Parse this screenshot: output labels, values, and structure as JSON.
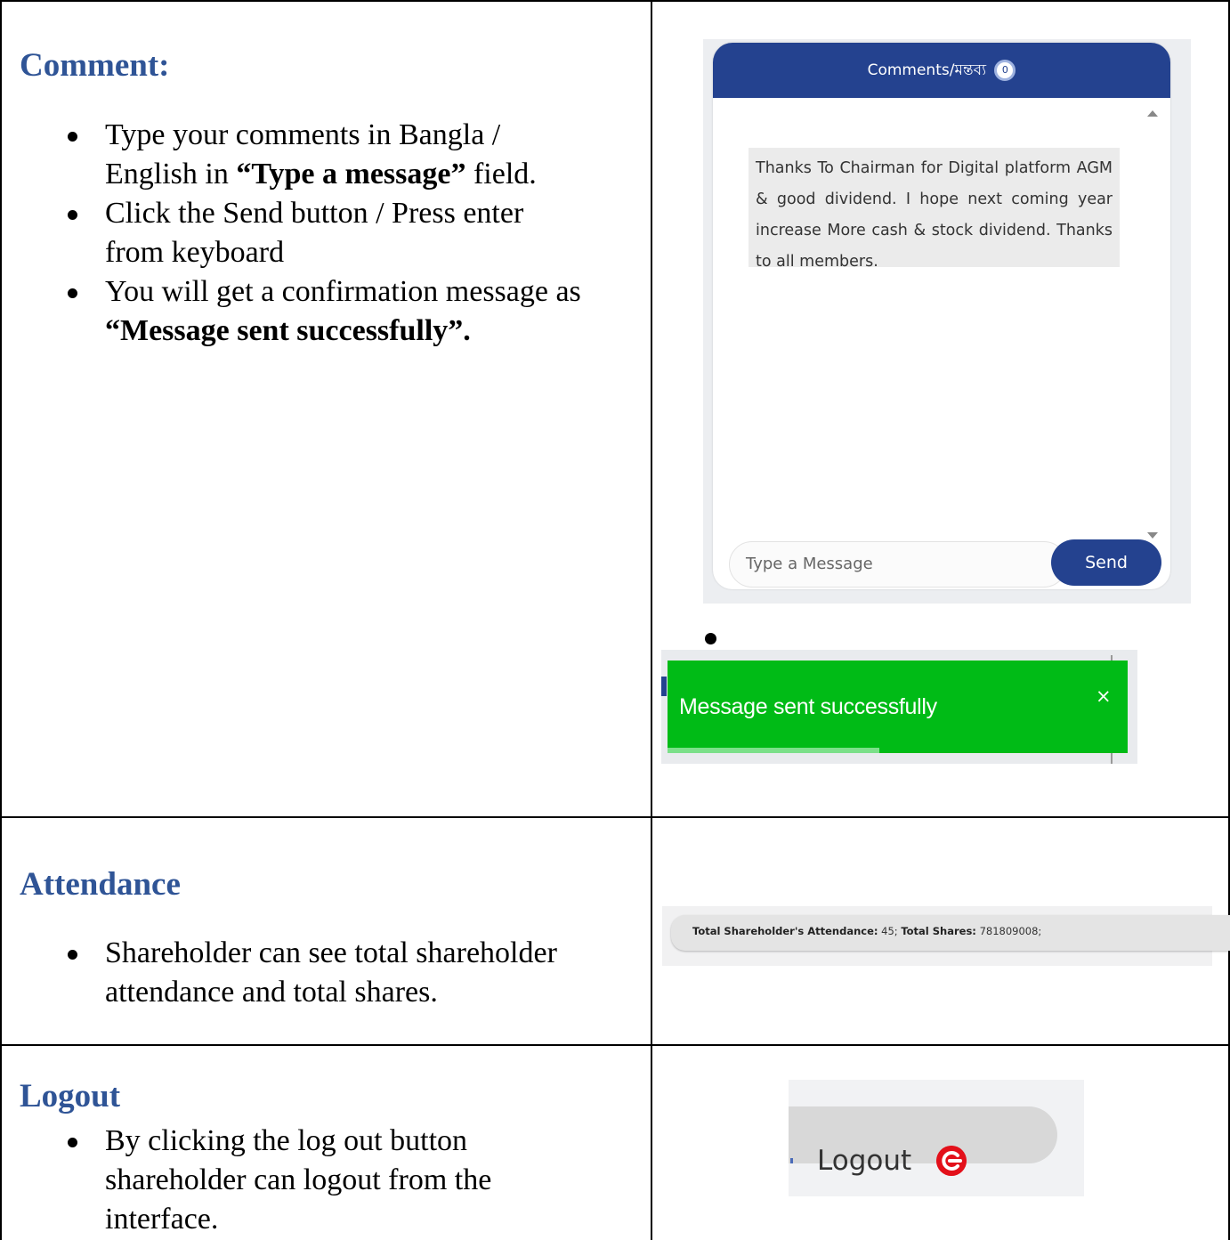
{
  "sections": {
    "comment": {
      "heading": "Comment:",
      "bullets": [
        {
          "lines": [
            "Type your comments in Bangla /"
          ],
          "line2_pre": "English in ",
          "line2_bold": "“Type a message”",
          "line2_post": " field."
        },
        {
          "lines": [
            "Click the Send button / Press enter",
            "from keyboard"
          ]
        },
        {
          "line1": "You will get a confirmation message as",
          "line2_bold": "“Message sent successfully”."
        }
      ]
    },
    "attendance": {
      "heading": "Attendance",
      "bullet_lines": [
        "Shareholder can see total shareholder",
        "attendance and total shares."
      ]
    },
    "logout": {
      "heading": "Logout",
      "bullet_lines": [
        "By clicking the log out button",
        "shareholder can logout from the",
        "interface."
      ]
    }
  },
  "chat_widget": {
    "title": "Comments/মন্তব্য",
    "badge_count": "0",
    "message": "Thanks To Chairman for Digital platform AGM & good dividend. I hope next coming year increase More cash & stock dividend. Thanks to all members.",
    "input_placeholder": "Type a Message",
    "send_label": "Send"
  },
  "toast": {
    "text": "Message sent successfully",
    "close_symbol": "×",
    "progress_fraction": 0.46,
    "color": "#00bb16"
  },
  "attendance_bar": {
    "label1": "Total Shareholder's Attendance:",
    "value1": "45;",
    "label2": "Total Shares:",
    "value2": "781809008;"
  },
  "logout_button": {
    "label": "Logout",
    "icon": "power-icon",
    "icon_color": "#e3101a"
  },
  "colors": {
    "heading": "#2f5496",
    "chat_header": "#24428f"
  }
}
